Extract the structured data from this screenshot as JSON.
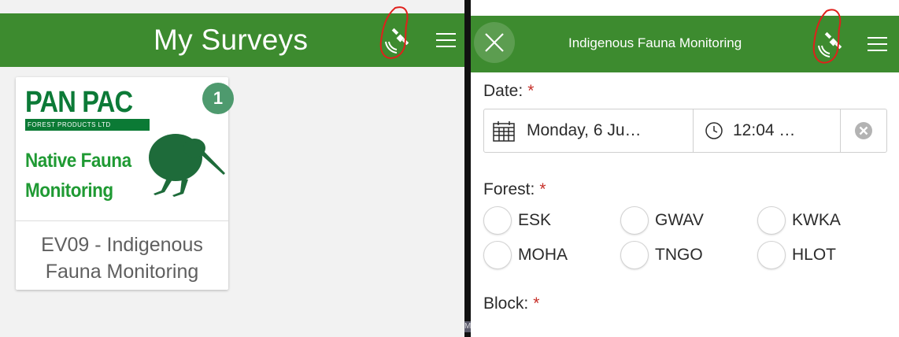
{
  "left": {
    "header": {
      "title": "My Surveys",
      "gps_icon": "satellite-gps-icon",
      "menu_icon": "hamburger-menu-icon"
    },
    "survey_card": {
      "logo": {
        "brand": "PAN PAC",
        "subtitle": "FOREST PRODUCTS LTD",
        "line1": "Native Fauna",
        "line2": "Monitoring"
      },
      "title": "EV09 - Indigenous Fauna Monitoring",
      "badge_count": "1"
    }
  },
  "right": {
    "header": {
      "close_icon": "close-icon",
      "title": "Indigenous Fauna Monitoring",
      "gps_icon": "satellite-gps-icon",
      "menu_icon": "hamburger-menu-icon"
    },
    "date_field": {
      "label": "Date:",
      "required_mark": "*",
      "date_value": "Monday, 6 Ju…",
      "time_value": "12:04 …",
      "calendar_icon": "calendar-icon",
      "clock_icon": "clock-icon",
      "clear_icon": "clear-circle-icon"
    },
    "forest_field": {
      "label": "Forest:",
      "required_mark": "*",
      "options": [
        "ESK",
        "GWAV",
        "KWKA",
        "MOHA",
        "TNGO",
        "HLOT"
      ]
    },
    "block_field": {
      "label": "Block:",
      "required_mark": "*"
    }
  },
  "divider_marker": "M",
  "colors": {
    "header_green": "#3d8b2f",
    "logo_green": "#0c7a37",
    "badge_green": "#4e9a6e",
    "required_red": "#c7302a",
    "annotation_red": "#e0201b"
  }
}
